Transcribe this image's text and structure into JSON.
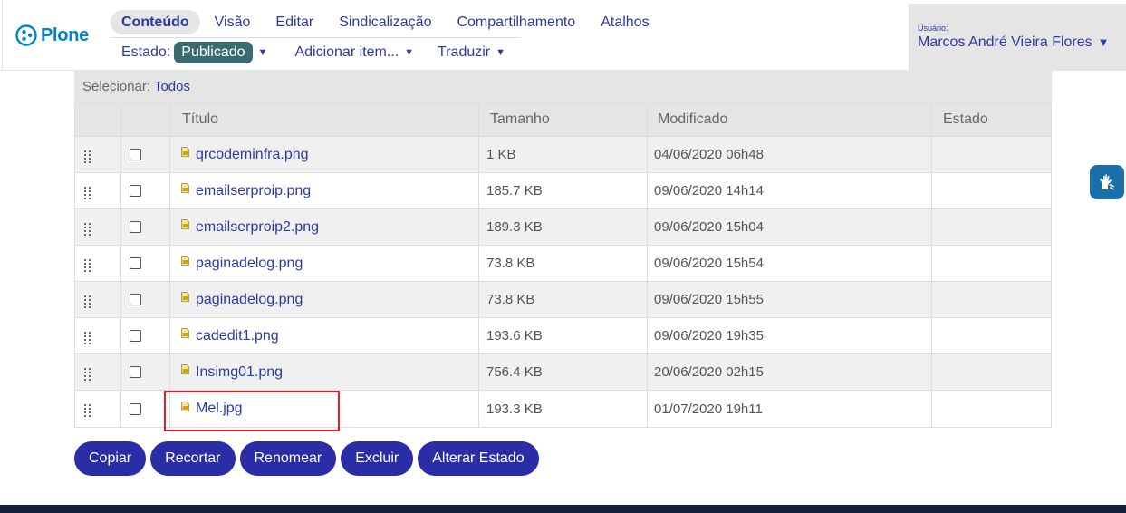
{
  "brand": {
    "name": "Plone",
    "color": "#0083be"
  },
  "toolbar": {
    "menu_top": [
      "Conteúdo",
      "Visão",
      "Editar",
      "Sindicalização",
      "Compartilhamento",
      "Atalhos"
    ],
    "active_index": 0,
    "state_label": "Estado:",
    "state_value": "Publicado",
    "add_item": "Adicionar item...",
    "translate": "Traduzir"
  },
  "user": {
    "label": "Usuário:",
    "name": "Marcos André Vieira Flores"
  },
  "table": {
    "select_label": "Selecionar:",
    "select_all": "Todos",
    "columns": [
      "Título",
      "Tamanho",
      "Modificado",
      "Estado"
    ],
    "rows": [
      {
        "title": "qrcodeminfra.png",
        "size": "1 KB",
        "modified": "04/06/2020 06h48",
        "state": ""
      },
      {
        "title": "emailserproip.png",
        "size": "185.7 KB",
        "modified": "09/06/2020 14h14",
        "state": ""
      },
      {
        "title": "emailserproip2.png",
        "size": "189.3 KB",
        "modified": "09/06/2020 15h04",
        "state": ""
      },
      {
        "title": "paginadelog.png",
        "size": "73.8 KB",
        "modified": "09/06/2020 15h54",
        "state": ""
      },
      {
        "title": "paginadelog.png",
        "size": "73.8 KB",
        "modified": "09/06/2020 15h55",
        "state": ""
      },
      {
        "title": "cadedit1.png",
        "size": "193.6 KB",
        "modified": "09/06/2020 19h35",
        "state": ""
      },
      {
        "title": "Insimg01.png",
        "size": "756.4 KB",
        "modified": "20/06/2020 02h15",
        "state": ""
      },
      {
        "title": "Mel.jpg",
        "size": "193.3 KB",
        "modified": "01/07/2020 19h11",
        "state": ""
      }
    ]
  },
  "actions": [
    "Copiar",
    "Recortar",
    "Renomear",
    "Excluir",
    "Alterar Estado"
  ],
  "icons": {
    "logo": "plone-logo-icon",
    "accessibility": "sign-language-icon",
    "file": "image-file-icon",
    "drag": "drag-handle-icon"
  }
}
